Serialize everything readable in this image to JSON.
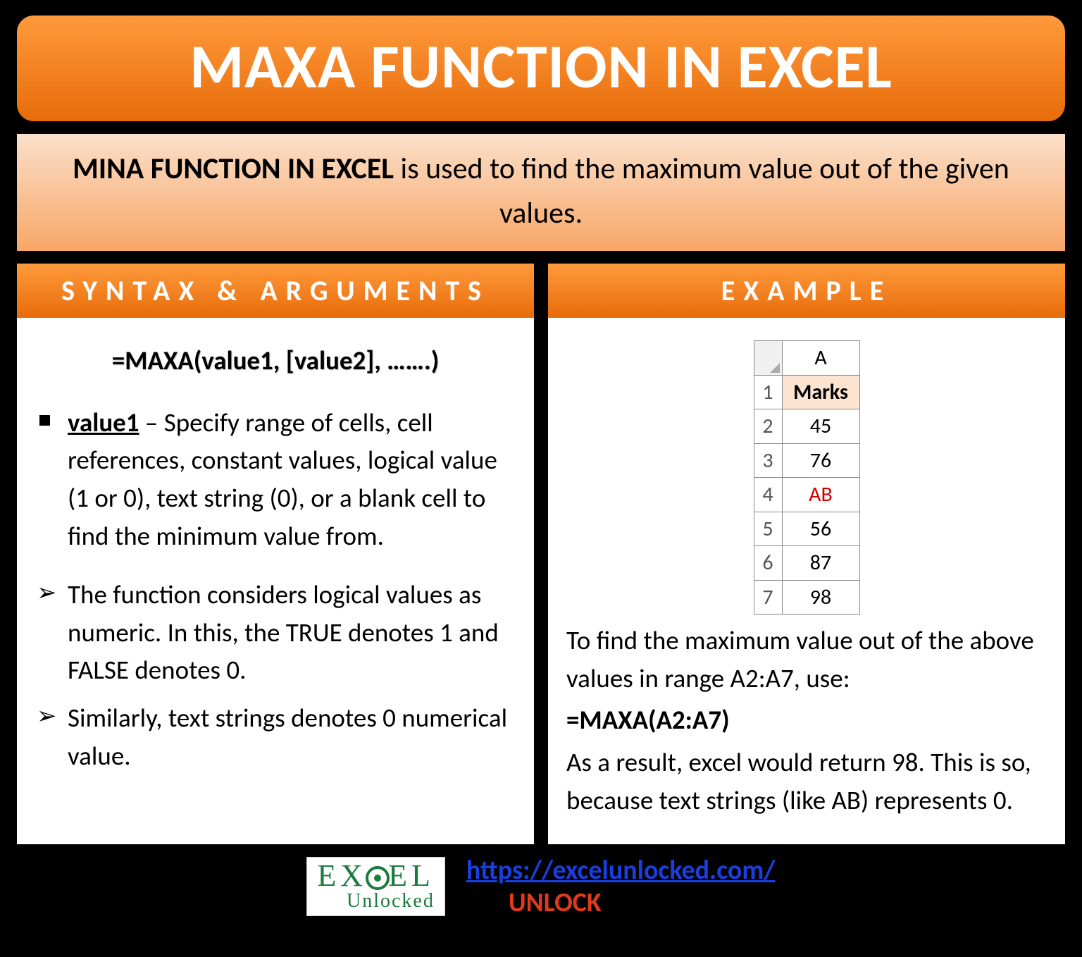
{
  "title": "MAXA FUNCTION IN EXCEL",
  "description": {
    "bold": "MINA FUNCTION IN EXCEL",
    "rest": " is used to find the maximum value out of the given values."
  },
  "syntax": {
    "heading": "SYNTAX & ARGUMENTS",
    "formula": "=MAXA(value1, [value2], …….)",
    "arg_name": "value1",
    "arg_desc": " – Specify range of cells, cell references, constant values, logical value (1 or 0), text string (0), or a blank cell to find the minimum value from.",
    "note1": "The function considers logical values as numeric. In this, the TRUE denotes 1 and FALSE denotes 0.",
    "note2": "Similarly, text strings denotes 0 numerical value."
  },
  "example": {
    "heading": "EXAMPLE",
    "col_header": "A",
    "row_header_label": "Marks",
    "rows": [
      {
        "n": "1",
        "v": "Marks"
      },
      {
        "n": "2",
        "v": "45"
      },
      {
        "n": "3",
        "v": "76"
      },
      {
        "n": "4",
        "v": "AB"
      },
      {
        "n": "5",
        "v": "56"
      },
      {
        "n": "6",
        "v": "87"
      },
      {
        "n": "7",
        "v": "98"
      }
    ],
    "text1": "To find the maximum value out of the above values in range A2:A7, use:",
    "formula": "=MAXA(A2:A7)",
    "text2": "As a result, excel would return 98. This is so, because text strings (like AB) represents 0."
  },
  "footer": {
    "logo_top_left": "EX",
    "logo_top_right": "EL",
    "logo_bottom": "Unlocked",
    "url": "https://excelunlocked.com/",
    "unlock": "UNLOCK"
  }
}
